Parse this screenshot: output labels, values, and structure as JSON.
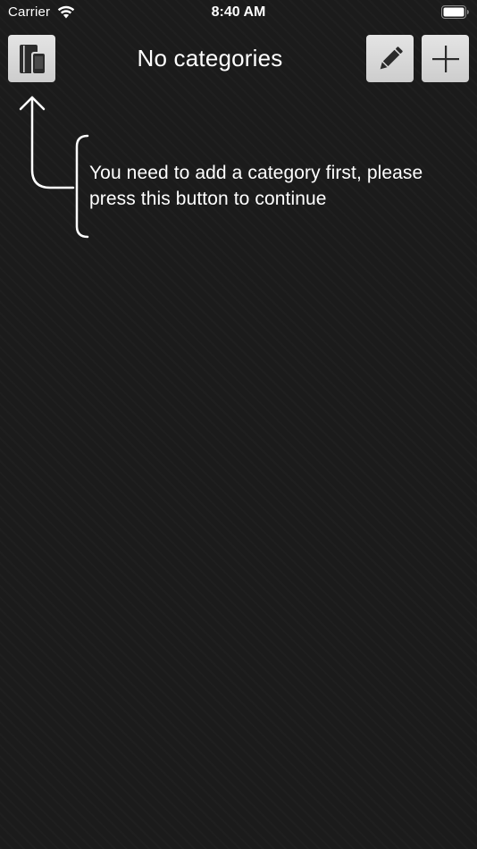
{
  "status_bar": {
    "carrier": "Carrier",
    "time": "8:40 AM"
  },
  "nav": {
    "title": "No categories",
    "left_button_icon": "book-phone-icon",
    "right_buttons": [
      {
        "icon": "pencil-icon"
      },
      {
        "icon": "plus-icon"
      }
    ]
  },
  "hint": {
    "text": "You need to add a category first, please press this button to continue"
  },
  "colors": {
    "background": "#1b1b1b",
    "button": "#d6d6d6",
    "icon": "#2b2b2b",
    "text": "#ffffff"
  }
}
